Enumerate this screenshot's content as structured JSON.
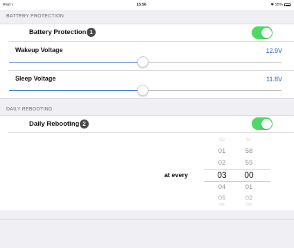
{
  "status_bar": {
    "device": "iPad",
    "wifi_icon": "wifi-icon",
    "time": "15:56",
    "bluetooth_icon": "bluetooth-icon",
    "battery_text": "95%",
    "battery_icon": "battery-icon"
  },
  "battery_section": {
    "header": "BATTERY PROTECTION",
    "toggle_label": "Battery Protection",
    "toggle_badge": "1",
    "toggle_on": true,
    "wakeup": {
      "label": "Wakeup Voltage",
      "value": "12.9V",
      "fraction": 0.49
    },
    "sleep": {
      "label": "Sleep Voltage",
      "value": "11.8V",
      "fraction": 0.49
    }
  },
  "reboot_section": {
    "header": "DAILY REBOOTING",
    "toggle_label": "Daily Rebooting",
    "toggle_badge": "2",
    "toggle_on": true,
    "picker_label": "at every",
    "hours": [
      "00",
      "01",
      "02",
      "03",
      "04",
      "05",
      "06"
    ],
    "minutes": [
      "57",
      "58",
      "59",
      "00",
      "01",
      "02",
      "03"
    ],
    "selected_hour": "03",
    "selected_minute": "00"
  },
  "colors": {
    "toggle_on": "#4cd964",
    "value_blue": "#1f5fb5",
    "slider_fill": "#2f6fc7",
    "background": "#efeff4"
  }
}
